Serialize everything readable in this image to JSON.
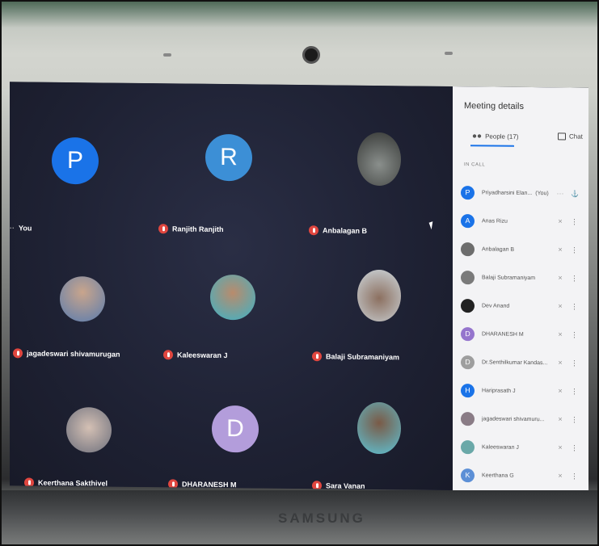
{
  "laptop": {
    "brand": "SAMSUNG"
  },
  "grid": {
    "tiles": [
      {
        "name": "You",
        "initial": "P",
        "color": "#1a73e8",
        "kind": "letter"
      },
      {
        "name": "Ranjith Ranjith",
        "initial": "R",
        "color": "#3c8fd6",
        "kind": "letter"
      },
      {
        "name": "Anbalagan B",
        "kind": "photo"
      },
      {
        "name": "jagadeswari shivamurugan",
        "kind": "photo"
      },
      {
        "name": "Kaleeswaran J",
        "kind": "photo"
      },
      {
        "name": "Balaji Subramaniyam",
        "kind": "photo"
      },
      {
        "name": "Keerthana Sakthivel",
        "kind": "photo"
      },
      {
        "name": "DHARANESH M",
        "initial": "D",
        "color": "#b39ddb",
        "kind": "letter"
      },
      {
        "name": "Sara Vanan",
        "kind": "photo"
      }
    ]
  },
  "panel": {
    "title": "Meeting details",
    "people_tab": "People (17)",
    "chat_tab": "Chat",
    "section_label": "IN CALL",
    "people": [
      {
        "name": "Priyadharsini Elan...",
        "suffix": "(You)",
        "initial": "P",
        "color": "#1a73e8"
      },
      {
        "name": "Anas Rizu",
        "initial": "A",
        "color": "#1a73e8"
      },
      {
        "name": "Anbalagan B",
        "initial": "",
        "color": "#6d6d6d"
      },
      {
        "name": "Balaji Subramaniyam",
        "initial": "",
        "color": "#7a7a7a"
      },
      {
        "name": "Dev Anand",
        "initial": "",
        "color": "#222222"
      },
      {
        "name": "DHARANESH M",
        "initial": "D",
        "color": "#9575cd"
      },
      {
        "name": "Dr.Senthilkumar Kandas...",
        "initial": "D",
        "color": "#9e9e9e"
      },
      {
        "name": "Hariprasath J",
        "initial": "H",
        "color": "#1a73e8"
      },
      {
        "name": "jagadeswari shivamuru...",
        "initial": "",
        "color": "#8a7c86"
      },
      {
        "name": "Kaleeswaran J",
        "initial": "",
        "color": "#6aa8a8"
      },
      {
        "name": "Keerthana G",
        "initial": "K",
        "color": "#5c8fd6"
      }
    ]
  }
}
